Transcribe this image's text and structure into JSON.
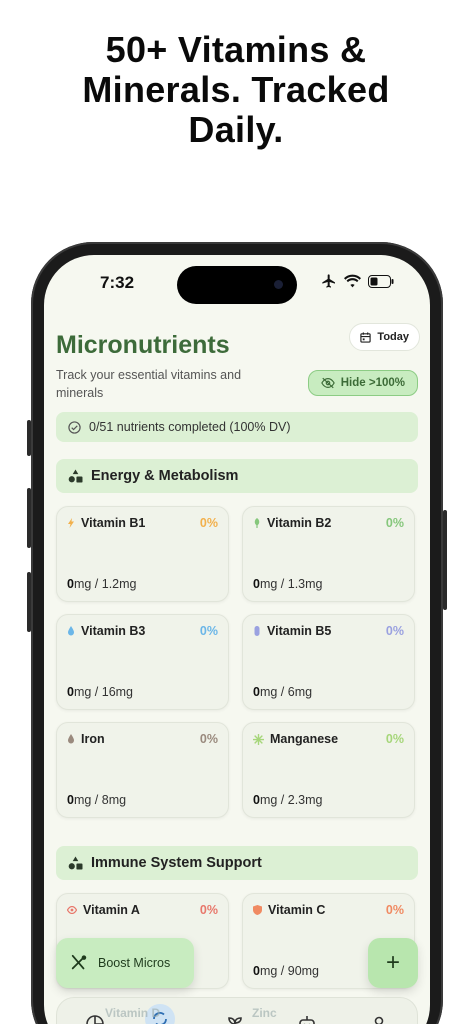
{
  "headline": [
    "50+ Vitamins &",
    "Minerals. Tracked",
    "Daily."
  ],
  "status": {
    "time": "7:32"
  },
  "header": {
    "title": "Micronutrients",
    "subtitle": "Track your essential vitamins and minerals",
    "today_label": "Today",
    "hide_label": "Hide >100%"
  },
  "progress": {
    "text": "0/51 nutrients completed (100% DV)"
  },
  "sections": [
    {
      "title": "Energy & Metabolism",
      "cards": [
        {
          "name": "Vitamin B1",
          "pct": "0%",
          "value": "0",
          "target": "mg / 1.2mg",
          "color": "#f2b04c"
        },
        {
          "name": "Vitamin B2",
          "pct": "0%",
          "value": "0",
          "target": "mg / 1.3mg",
          "color": "#86c77c"
        },
        {
          "name": "Vitamin B3",
          "pct": "0%",
          "value": "0",
          "target": "mg / 16mg",
          "color": "#6bb6e8"
        },
        {
          "name": "Vitamin B5",
          "pct": "0%",
          "value": "0",
          "target": "mg / 6mg",
          "color": "#9aa1e0"
        },
        {
          "name": "Iron",
          "pct": "0%",
          "value": "0",
          "target": "mg / 8mg",
          "color": "#9a8a7e"
        },
        {
          "name": "Manganese",
          "pct": "0%",
          "value": "0",
          "target": "mg / 2.3mg",
          "color": "#a6d67a"
        }
      ]
    },
    {
      "title": "Immune System Support",
      "cards": [
        {
          "name": "Vitamin A",
          "pct": "0%",
          "value": "",
          "target": "",
          "color": "#e8786c"
        },
        {
          "name": "Vitamin C",
          "pct": "0%",
          "value": "0",
          "target": "mg / 90mg",
          "color": "#f08a62"
        }
      ]
    }
  ],
  "actions": {
    "boost_label": "Boost Micros",
    "fab_label": "+"
  },
  "tabbar": {
    "items": [
      "Vitamin D",
      "Zinc"
    ]
  }
}
